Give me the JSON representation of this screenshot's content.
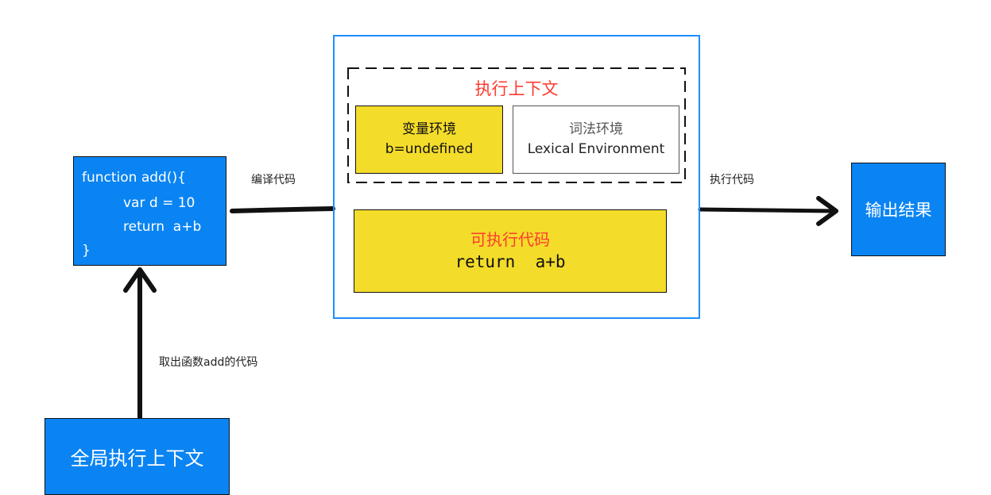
{
  "code_box": {
    "lines": [
      "function add(){",
      "var d = 10",
      "return  a+b",
      "}"
    ]
  },
  "global_context": {
    "label": "全局执行上下文"
  },
  "arrows": {
    "extract_label": "取出函数add的代码",
    "compile_label": "编译代码",
    "execute_label": "执行代码"
  },
  "execution_context": {
    "title": "执行上下文",
    "variable_env": {
      "title": "变量环境",
      "value": "b=undefined"
    },
    "lexical_env": {
      "title": "词法环境",
      "subtitle": "Lexical Environment"
    }
  },
  "executable_code": {
    "title": "可执行代码",
    "code": "return  a+b"
  },
  "output": {
    "label": "输出结果"
  },
  "colors": {
    "blue": "#0a84f2",
    "yellow": "#f4dc2a",
    "red_text": "#ff3b30",
    "frame_blue": "#1d8fff"
  }
}
